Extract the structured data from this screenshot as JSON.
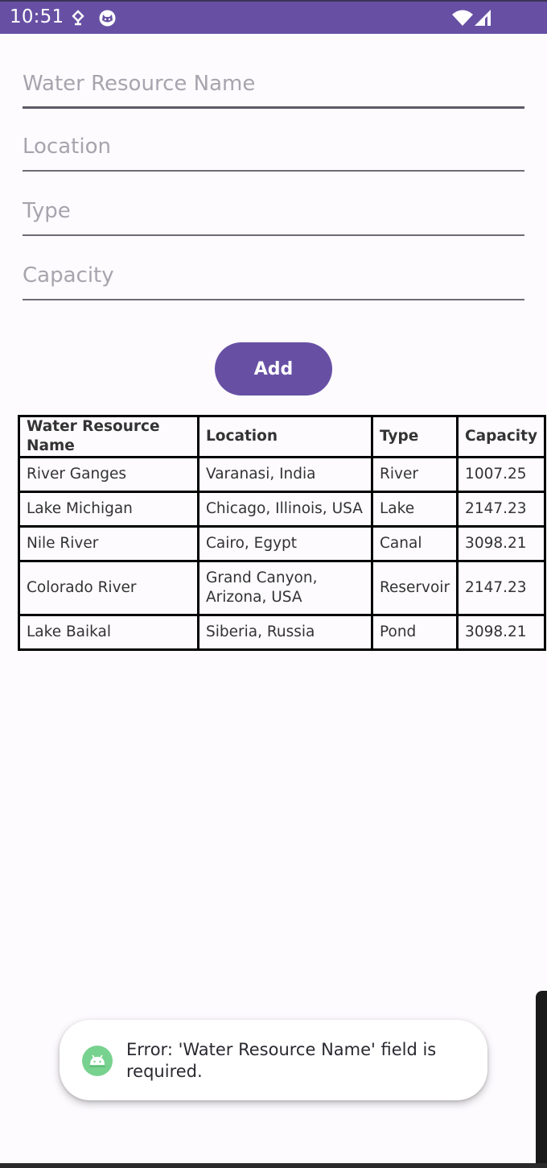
{
  "status_bar": {
    "time": "10:51",
    "icons": [
      "notification-status-icon",
      "cat-status-icon",
      "wifi-icon",
      "signal-icon"
    ],
    "background_color": "#6750a4"
  },
  "form": {
    "fields": [
      {
        "placeholder": "Water Resource Name",
        "value": ""
      },
      {
        "placeholder": "Location",
        "value": ""
      },
      {
        "placeholder": "Type",
        "value": ""
      },
      {
        "placeholder": "Capacity",
        "value": ""
      }
    ],
    "add_label": "Add"
  },
  "table": {
    "headers": [
      "Water Resource Name",
      "Location",
      "Type",
      "Capacity"
    ],
    "rows": [
      [
        "River Ganges",
        "Varanasi, India",
        "River",
        "1007.25"
      ],
      [
        "Lake Michigan",
        "Chicago, Illinois, USA",
        "Lake",
        "2147.23"
      ],
      [
        "Nile River",
        "Cairo, Egypt",
        "Canal",
        "3098.21"
      ],
      [
        "Colorado River",
        "Grand Canyon, Arizona, USA",
        "Reservoir",
        "2147.23"
      ],
      [
        "Lake Baikal",
        "Siberia, Russia",
        "Pond",
        "3098.21"
      ]
    ]
  },
  "toast": {
    "icon": "android-icon",
    "message": "Error: 'Water Resource Name' field is required."
  },
  "colors": {
    "primary": "#6750a4",
    "background": "#fdfbfe",
    "toast_icon": "#78d28f"
  }
}
